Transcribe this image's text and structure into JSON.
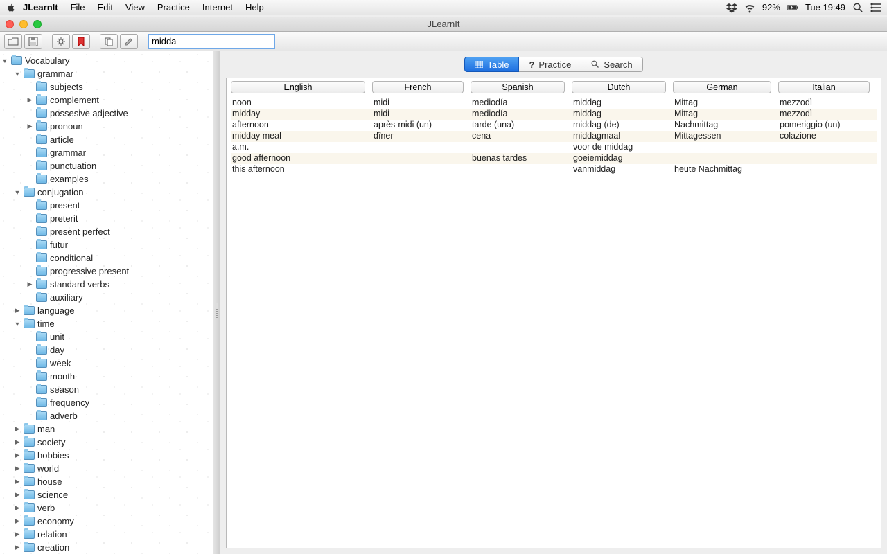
{
  "menubar": {
    "appname": "JLearnIt",
    "items": [
      "File",
      "Edit",
      "View",
      "Practice",
      "Internet",
      "Help"
    ],
    "status": {
      "battery": "92%",
      "clock": "Tue 19:49"
    }
  },
  "window": {
    "title": "JLearnIt"
  },
  "toolbar": {
    "search_value": "midda"
  },
  "tree": [
    {
      "indent": 0,
      "disc": "down",
      "label": "Vocabulary"
    },
    {
      "indent": 1,
      "disc": "down",
      "label": "grammar"
    },
    {
      "indent": 2,
      "disc": "",
      "label": "subjects"
    },
    {
      "indent": 2,
      "disc": "right",
      "label": "complement"
    },
    {
      "indent": 2,
      "disc": "",
      "label": "possesive adjective"
    },
    {
      "indent": 2,
      "disc": "right",
      "label": "pronoun"
    },
    {
      "indent": 2,
      "disc": "",
      "label": "article"
    },
    {
      "indent": 2,
      "disc": "",
      "label": "grammar"
    },
    {
      "indent": 2,
      "disc": "",
      "label": "punctuation"
    },
    {
      "indent": 2,
      "disc": "",
      "label": "examples"
    },
    {
      "indent": 1,
      "disc": "down",
      "label": "conjugation"
    },
    {
      "indent": 2,
      "disc": "",
      "label": "present"
    },
    {
      "indent": 2,
      "disc": "",
      "label": "preterit"
    },
    {
      "indent": 2,
      "disc": "",
      "label": "present perfect"
    },
    {
      "indent": 2,
      "disc": "",
      "label": "futur"
    },
    {
      "indent": 2,
      "disc": "",
      "label": "conditional"
    },
    {
      "indent": 2,
      "disc": "",
      "label": "progressive present"
    },
    {
      "indent": 2,
      "disc": "right",
      "label": "standard verbs"
    },
    {
      "indent": 2,
      "disc": "",
      "label": "auxiliary"
    },
    {
      "indent": 1,
      "disc": "right",
      "label": "language"
    },
    {
      "indent": 1,
      "disc": "down",
      "label": "time"
    },
    {
      "indent": 2,
      "disc": "",
      "label": "unit"
    },
    {
      "indent": 2,
      "disc": "",
      "label": "day"
    },
    {
      "indent": 2,
      "disc": "",
      "label": "week"
    },
    {
      "indent": 2,
      "disc": "",
      "label": "month"
    },
    {
      "indent": 2,
      "disc": "",
      "label": "season"
    },
    {
      "indent": 2,
      "disc": "",
      "label": "frequency"
    },
    {
      "indent": 2,
      "disc": "",
      "label": "adverb"
    },
    {
      "indent": 1,
      "disc": "right",
      "label": "man"
    },
    {
      "indent": 1,
      "disc": "right",
      "label": "society"
    },
    {
      "indent": 1,
      "disc": "right",
      "label": "hobbies"
    },
    {
      "indent": 1,
      "disc": "right",
      "label": "world"
    },
    {
      "indent": 1,
      "disc": "right",
      "label": "house"
    },
    {
      "indent": 1,
      "disc": "right",
      "label": "science"
    },
    {
      "indent": 1,
      "disc": "right",
      "label": "verb"
    },
    {
      "indent": 1,
      "disc": "right",
      "label": "economy"
    },
    {
      "indent": 1,
      "disc": "right",
      "label": "relation"
    },
    {
      "indent": 1,
      "disc": "right",
      "label": "creation"
    }
  ],
  "seg": {
    "table": "Table",
    "practice": "Practice",
    "search": "Search"
  },
  "columns": [
    "English",
    "French",
    "Spanish",
    "Dutch",
    "German",
    "Italian"
  ],
  "rows": [
    [
      "noon",
      "midi",
      "mediodía",
      "middag",
      "Mittag",
      "mezzodì"
    ],
    [
      "midday",
      "midi",
      "mediodía",
      "middag",
      "Mittag",
      "mezzodì"
    ],
    [
      "afternoon",
      "après-midi (un)",
      "tarde (una)",
      "middag (de)",
      "Nachmittag",
      "pomeriggio (un)"
    ],
    [
      "midday meal",
      "dîner",
      "cena",
      "middagmaal",
      "Mittagessen",
      "colazione"
    ],
    [
      "a.m.",
      "",
      "",
      "voor de middag",
      "",
      ""
    ],
    [
      "good afternoon",
      "",
      "buenas tardes",
      "goeiemiddag",
      "",
      ""
    ],
    [
      "this afternoon",
      "",
      "",
      "vanmiddag",
      "heute Nachmittag",
      ""
    ]
  ]
}
